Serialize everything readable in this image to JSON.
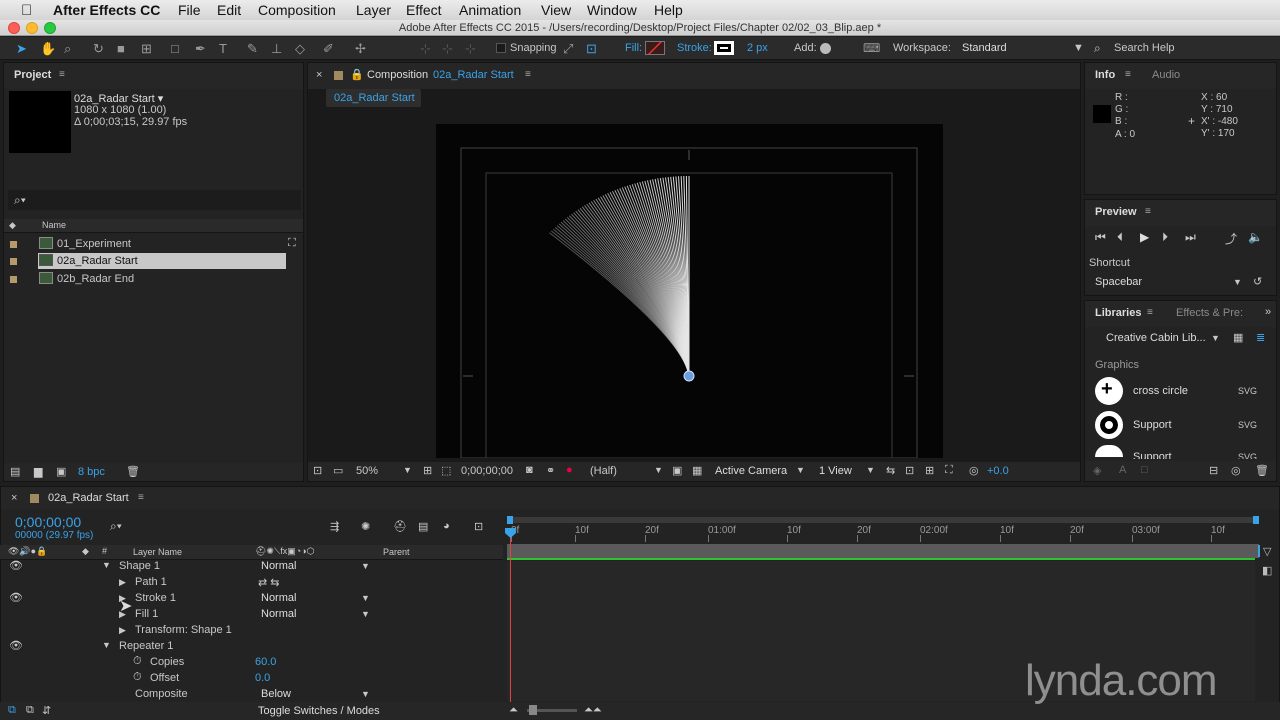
{
  "menubar": {
    "app": "After Effects CC",
    "items": [
      "File",
      "Edit",
      "Composition",
      "Layer",
      "Effect",
      "Animation",
      "View",
      "Window",
      "Help"
    ]
  },
  "titlebar": {
    "text": "Adobe After Effects CC 2015 - /Users/recording/Desktop/Project Files/Chapter 02/02_03_Blip.aep *"
  },
  "toolbar": {
    "snapping": "Snapping",
    "fill": "Fill:",
    "stroke": "Stroke:",
    "stroke_width": "2 px",
    "add": "Add:",
    "workspace_label": "Workspace:",
    "workspace_value": "Standard",
    "search_help": "Search Help"
  },
  "project": {
    "title": "Project",
    "comp_name": "02a_Radar Start ▾",
    "comp_size": "1080 x 1080 (1.00)",
    "comp_duration": "Δ 0;00;03;15, 29.97 fps",
    "col_name": "Name",
    "items": [
      "01_Experiment",
      "02a_Radar Start",
      "02b_Radar End"
    ],
    "bpc": "8 bpc"
  },
  "composition": {
    "tab_prefix": "Composition",
    "tab_name": "02a_Radar Start",
    "breadcrumb": "02a_Radar Start",
    "zoom": "50%",
    "timecode": "0;00;00;00",
    "resolution": "(Half)",
    "camera": "Active Camera",
    "views": "1 View",
    "exposure": "+0.0"
  },
  "info": {
    "tab_info": "Info",
    "tab_audio": "Audio",
    "r": "R :",
    "g": "G :",
    "b": "B :",
    "a": "A : 0",
    "x": "X : 60",
    "y": "Y : 710",
    "x2": "X' : -480",
    "y2": "Y' : 170"
  },
  "preview": {
    "title": "Preview",
    "shortcut_label": "Shortcut",
    "shortcut_value": "Spacebar"
  },
  "libraries": {
    "tab_libraries": "Libraries",
    "tab_effects": "Effects & Pre:",
    "library_name": "Creative Cabin Lib...",
    "section": "Graphics",
    "items": [
      {
        "name": "cross circle",
        "type": "SVG"
      },
      {
        "name": "Support",
        "type": "SVG"
      },
      {
        "name": "Support",
        "type": "SVG"
      }
    ]
  },
  "timeline": {
    "tab": "02a_Radar Start",
    "timecode": "0;00;00;00",
    "frames": "00000 (29.97 fps)",
    "col_layer": "Layer Name",
    "col_parent": "Parent",
    "col_hash": "#",
    "rows": [
      {
        "name": "Shape 1",
        "mode": "Normal",
        "value": ""
      },
      {
        "name": "Path 1",
        "mode": "",
        "value": ""
      },
      {
        "name": "Stroke 1",
        "mode": "Normal",
        "value": ""
      },
      {
        "name": "Fill 1",
        "mode": "Normal",
        "value": ""
      },
      {
        "name": "Transform: Shape 1",
        "mode": "",
        "value": ""
      },
      {
        "name": "Repeater 1",
        "mode": "",
        "value": ""
      },
      {
        "name": "Copies",
        "mode": "",
        "value": "60.0"
      },
      {
        "name": "Offset",
        "mode": "",
        "value": "0.0"
      },
      {
        "name": "Composite",
        "mode": "Below",
        "value": ""
      }
    ],
    "ruler": [
      "0f",
      "10f",
      "20f",
      "01:00f",
      "10f",
      "20f",
      "02:00f",
      "10f",
      "20f",
      "03:00f",
      "10f"
    ],
    "toggle": "Toggle Switches / Modes"
  },
  "watermark": "lynda.com",
  "colors": {
    "accent": "#3aa3e8",
    "selection": "#c8c8c8",
    "workarea": "#5a5a5a",
    "green_bar": "#2fc22f"
  }
}
